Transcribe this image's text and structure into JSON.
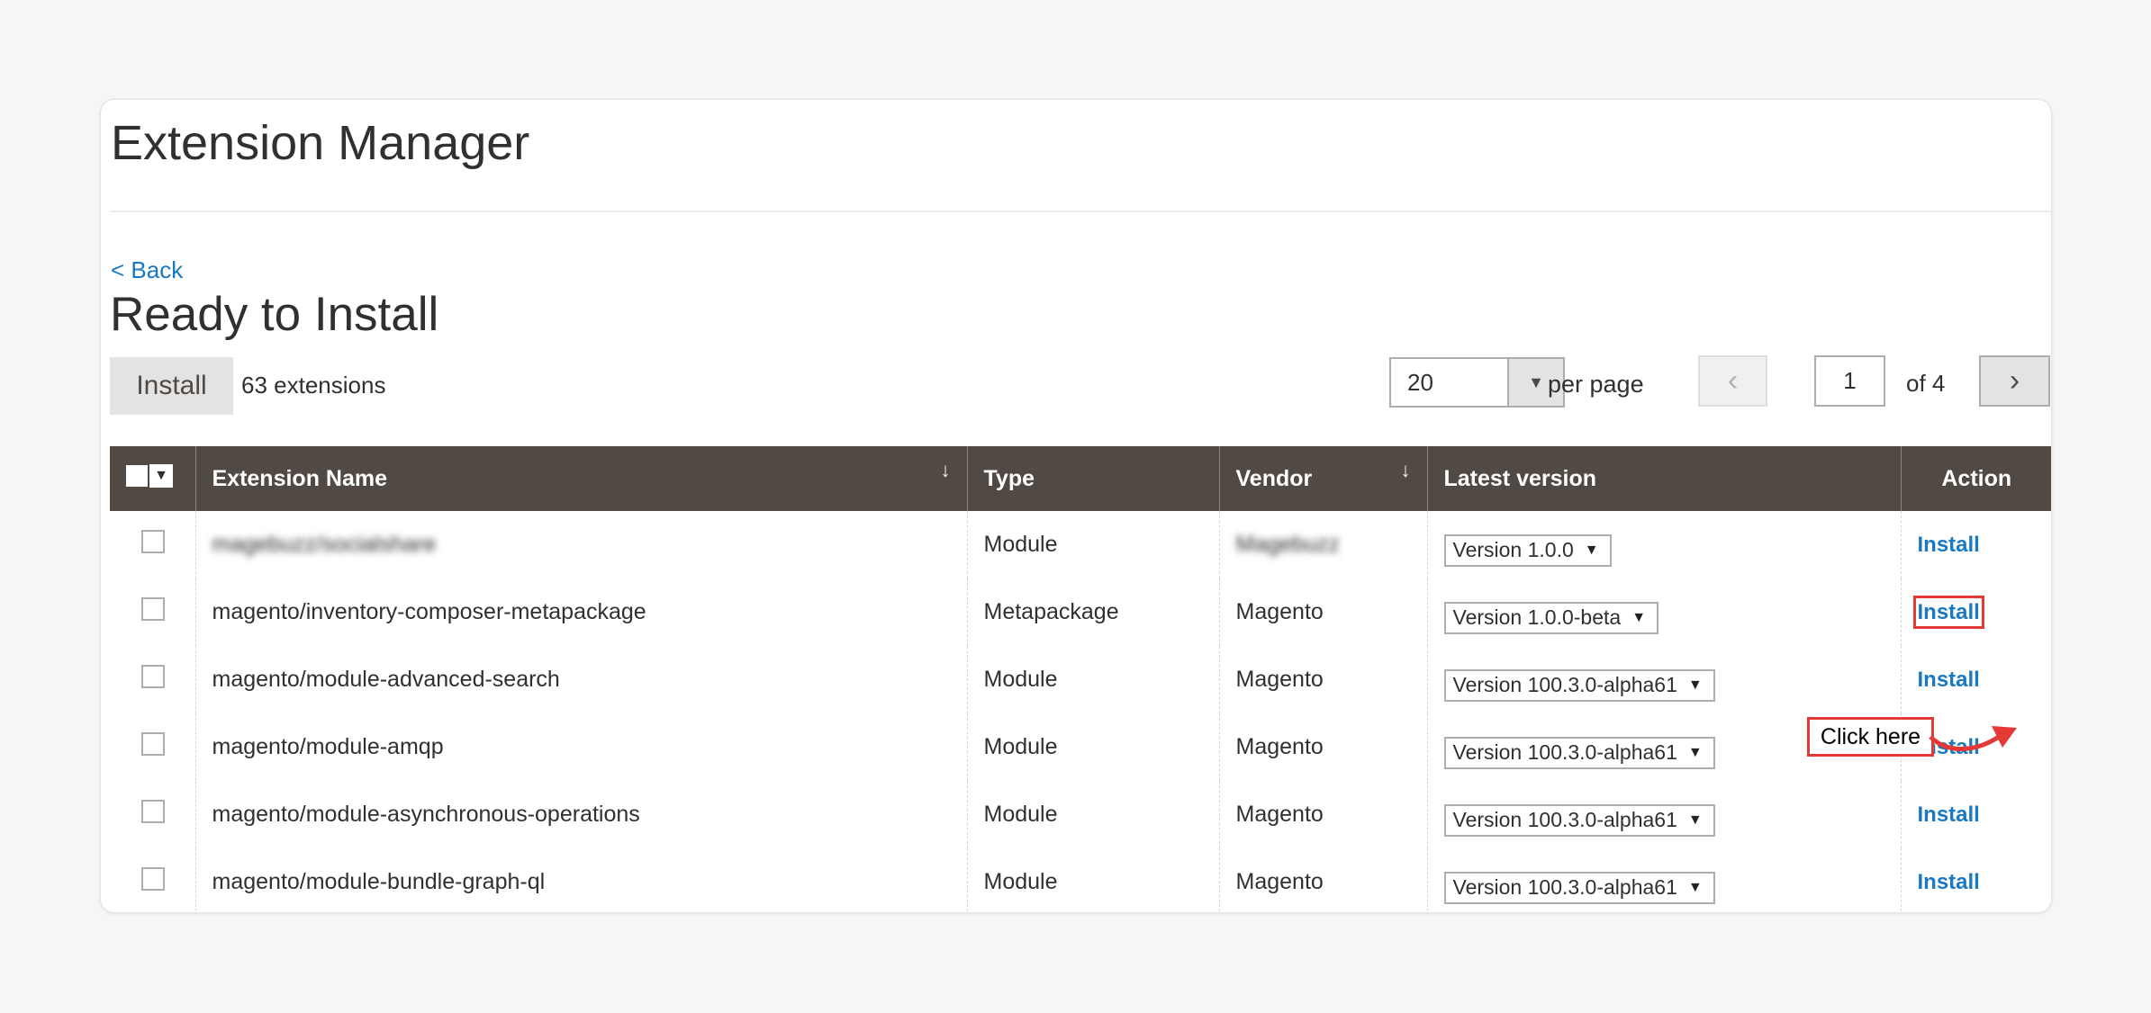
{
  "page": {
    "title": "Extension Manager",
    "back_label": "< Back",
    "section_title": "Ready to Install"
  },
  "toolbar": {
    "install_label": "Install",
    "extension_count": "63 extensions",
    "per_page_value": "20",
    "per_page_label": "per page",
    "current_page": "1",
    "page_of": "of 4"
  },
  "table": {
    "headers": {
      "name": "Extension Name",
      "type": "Type",
      "vendor": "Vendor",
      "version": "Latest version",
      "action": "Action"
    },
    "rows": [
      {
        "name": "magebuzz/socialshare",
        "type": "Module",
        "vendor": "Magebuzz",
        "version": "Version 1.0.0",
        "action": "Install",
        "blurred": true
      },
      {
        "name": "magento/inventory-composer-metapackage",
        "type": "Metapackage",
        "vendor": "Magento",
        "version": "Version 1.0.0-beta",
        "action": "Install"
      },
      {
        "name": "magento/module-advanced-search",
        "type": "Module",
        "vendor": "Magento",
        "version": "Version 100.3.0-alpha61",
        "action": "Install"
      },
      {
        "name": "magento/module-amqp",
        "type": "Module",
        "vendor": "Magento",
        "version": "Version 100.3.0-alpha61",
        "action": "Install"
      },
      {
        "name": "magento/module-asynchronous-operations",
        "type": "Module",
        "vendor": "Magento",
        "version": "Version 100.3.0-alpha61",
        "action": "Install"
      },
      {
        "name": "magento/module-bundle-graph-ql",
        "type": "Module",
        "vendor": "Magento",
        "version": "Version 100.3.0-alpha61",
        "action": "Install"
      }
    ]
  },
  "annotation": {
    "callout_text": "Click here",
    "color": "#e53935"
  },
  "colors": {
    "header_bg": "#514943",
    "link": "#1979c3",
    "page_bg": "#f6f6f7"
  }
}
